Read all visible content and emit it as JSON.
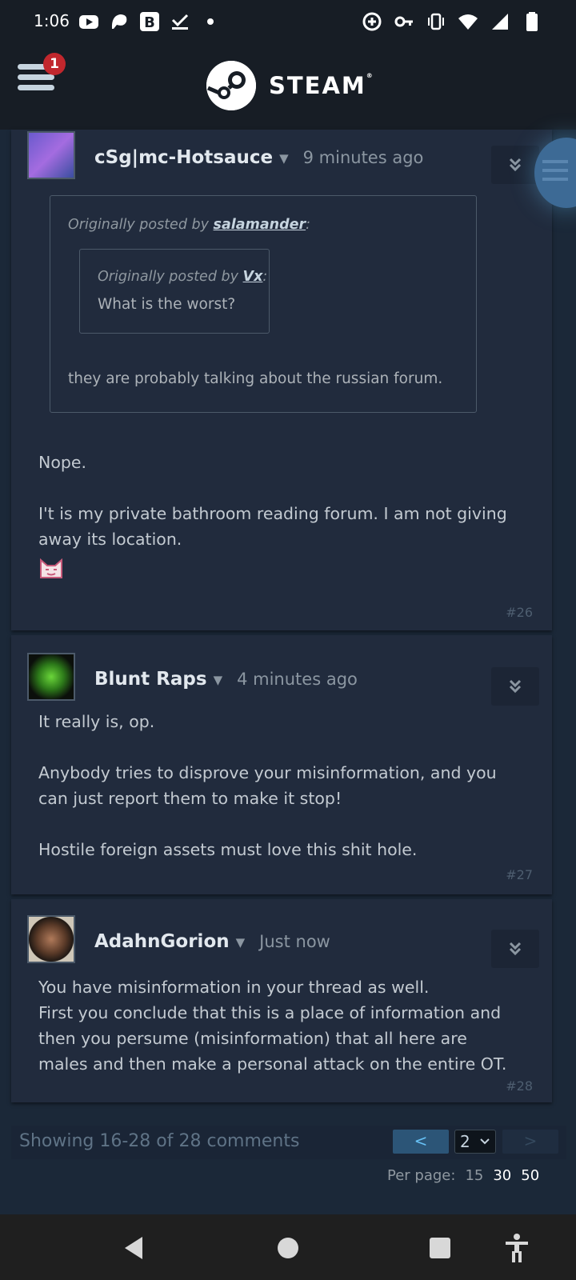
{
  "status": {
    "time": "1:06"
  },
  "header": {
    "notif_count": "1",
    "brand": "STEAM",
    "reg": "®"
  },
  "comments": [
    {
      "author": "cSg|mc-Hotsauce",
      "time": "9 minutes ago",
      "quote": {
        "attr_prefix": "Originally posted by",
        "user": "salamander",
        "nested": {
          "attr_prefix": "Originally posted by",
          "user": "Vx",
          "text": "What is the worst?"
        },
        "text": "they are probably talking about the russian forum."
      },
      "lines": [
        "Nope.",
        "",
        "I't is my private bathroom reading forum. I am not giving",
        "away its location."
      ],
      "number": "#26"
    },
    {
      "author": "Blunt Raps",
      "time": "4 minutes ago",
      "lines": [
        "It really is, op.",
        "",
        "Anybody tries to disprove your misinformation, and you",
        "can just report them to make it stop!",
        "",
        "Hostile foreign assets must love this shit hole."
      ],
      "number": "#27"
    },
    {
      "author": "AdahnGorion",
      "time": "Just now",
      "lines": [
        "You have misinformation in your thread as well.",
        "First you conclude that this is a place of information and",
        "then you persume (misinformation) that all here are",
        "males and then make a personal attack on the entire OT."
      ],
      "number": "#28"
    }
  ],
  "pagination": {
    "showing": "Showing 16-28 of 28 comments",
    "prev": "<",
    "current_page": "2",
    "next": ">",
    "per_page_label": "Per page:",
    "per_page_options": [
      "15",
      "30",
      "50"
    ]
  },
  "colors": {
    "accent": "#67c1f5",
    "background": "#1b2838",
    "panel": "#212b3d",
    "notif": "#c1272d"
  },
  "icons": [
    "youtube-icon",
    "patreon-icon",
    "bold-b-icon",
    "check-icon",
    "dot-icon",
    "add-circle-icon",
    "key-icon",
    "vibrate-icon",
    "wifi-icon",
    "signal-icon",
    "battery-icon",
    "menu-icon",
    "steam-logo-icon",
    "chevron-double-down-icon",
    "back-icon",
    "home-icon",
    "recents-icon",
    "accessibility-icon"
  ]
}
